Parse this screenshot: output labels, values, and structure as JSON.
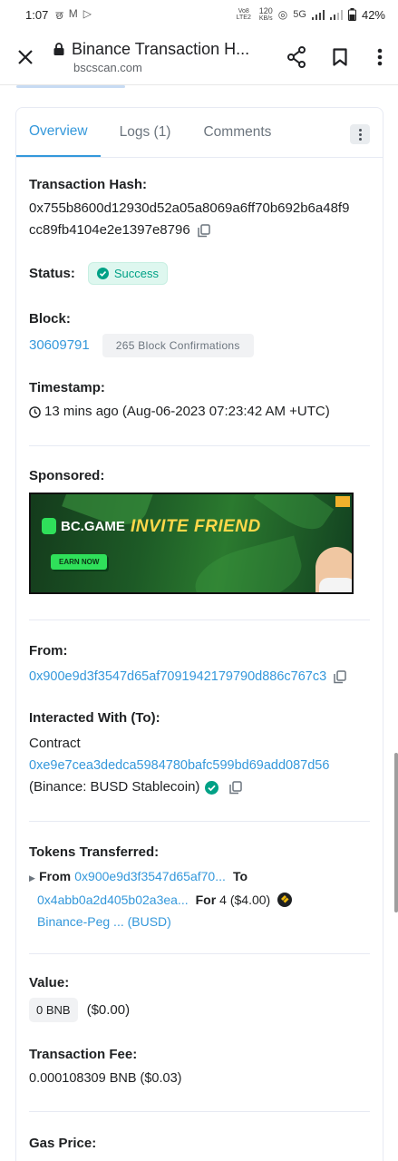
{
  "status_bar": {
    "time": "1:07",
    "notif_icons": [
      "छ",
      "M",
      "▷"
    ],
    "volte": "Vo8 LTE2",
    "speed_value": "120",
    "speed_unit": "KB/s",
    "network": "5G",
    "battery": "42%"
  },
  "browser": {
    "page_title": "Binance Transaction H...",
    "url": "bscscan.com"
  },
  "tabs": [
    {
      "label": "Overview"
    },
    {
      "label": "Logs (1)"
    },
    {
      "label": "Comments"
    }
  ],
  "tx": {
    "hash_label": "Transaction Hash:",
    "hash_line1": "0x755b8600d12930d52a05a8069a6ff70b692b6a48f9",
    "hash_line2": "cc89fb4104e2e1397e8796",
    "status_label": "Status:",
    "status_value": "Success",
    "block_label": "Block:",
    "block_number": "30609791",
    "block_confirmations": "265 Block Confirmations",
    "timestamp_label": "Timestamp:",
    "timestamp_value": "13 mins ago (Aug-06-2023 07:23:42 AM +UTC)",
    "sponsored_label": "Sponsored:",
    "ad_brand": "BC.GAME",
    "ad_headline": "INVITE FRIEND",
    "ad_button": "EARN NOW",
    "from_label": "From:",
    "from_address": "0x900e9d3f3547d65af7091942179790d886c767c3",
    "to_label": "Interacted With (To):",
    "to_type": "Contract",
    "to_address": "0xe9e7cea3dedca5984780bafc599bd69add087d56",
    "to_name": "(Binance: BUSD Stablecoin)",
    "tokens_label": "Tokens Transferred:",
    "token_from_word": "From",
    "token_from": "0x900e9d3f3547d65af70...",
    "token_to_word": "To",
    "token_to": "0x4abb0a2d405b02a3ea...",
    "token_for_word": "For",
    "token_amount": "4 ($4.00)",
    "token_name": "Binance-Peg ... (BUSD)",
    "value_label": "Value:",
    "value_bnb": "0 BNB",
    "value_usd": "($0.00)",
    "fee_label": "Transaction Fee:",
    "fee_value": "0.000108309 BNB ($0.03)",
    "gas_label": "Gas Price:"
  },
  "colors": {
    "link": "#3498db",
    "success": "#00a186",
    "success_bg": "#def7ef",
    "border": "#e7eaf3",
    "text": "#1e2022",
    "muted": "#6c757e"
  }
}
